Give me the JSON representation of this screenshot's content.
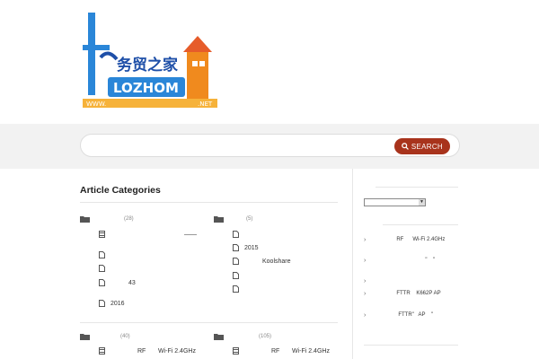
{
  "header": {
    "logo_text": "WWW.LOZHOME.NET",
    "logo_cn": "务贸之家"
  },
  "search": {
    "placeholder": "",
    "button_label": "SEARCH"
  },
  "main": {
    "title": "Article Categories",
    "categories": [
      {
        "count": "(28)",
        "items": [
          "——",
          "",
          "",
          "43",
          "2016"
        ]
      },
      {
        "count": "(5)",
        "items": [
          "",
          "2015",
          "Koolshare",
          "",
          ""
        ]
      },
      {
        "count": "(40)",
        "items": [
          "RF       Wi-Fi 2.4GHz"
        ]
      },
      {
        "count": "(105)",
        "items": [
          "RF       Wi-Fi 2.4GHz"
        ]
      }
    ]
  },
  "sidebar": {
    "select_value": "",
    "items": [
      "RF      Wi-Fi 2.4GHz",
      "\"    \"",
      "",
      "FTTR    K662P AP",
      "FTTR\"   AP    \""
    ]
  },
  "colors": {
    "accent": "#a8331c",
    "band": "#f2f2f2",
    "logo_blue": "#2a86d8",
    "logo_orange": "#f08a1e"
  }
}
